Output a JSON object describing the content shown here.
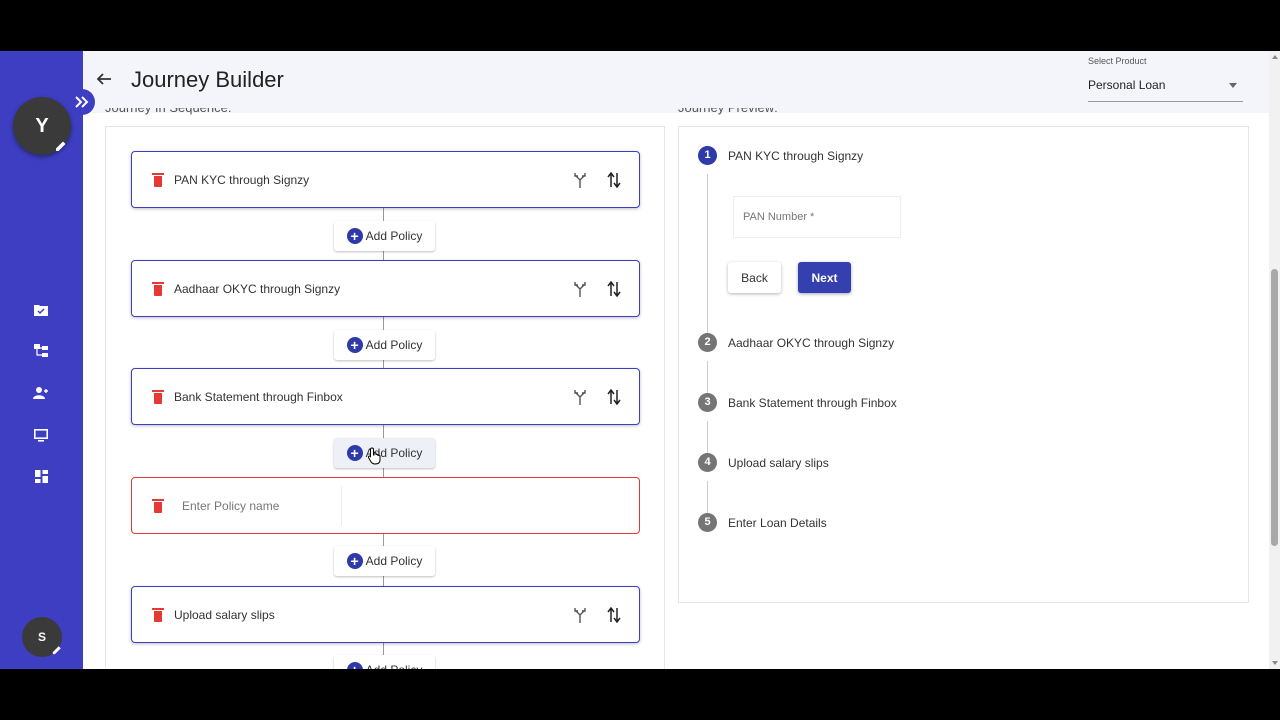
{
  "sidebar": {
    "avatar_initial": "Y",
    "user_initial": "S",
    "nav_items": [
      "folder-check-icon",
      "tree-structure-icon",
      "users-icon",
      "monitor-icon",
      "dashboard-icon"
    ]
  },
  "header": {
    "title": "Journey Builder",
    "product_select": {
      "label": "Select Product",
      "value": "Personal Loan"
    }
  },
  "left_panel": {
    "heading": "Journey In Sequence:",
    "policies": [
      {
        "name": "PAN KYC through Signzy"
      },
      {
        "name": "Aadhaar OKYC through Signzy"
      },
      {
        "name": "Bank Statement through Finbox"
      },
      {
        "name": "",
        "placeholder": "Enter Policy name",
        "editing": true
      },
      {
        "name": "Upload salary slips"
      }
    ],
    "add_policy_label": "Add Policy"
  },
  "right_panel": {
    "heading": "Journey Preview:",
    "steps": [
      {
        "num": "1",
        "label": "PAN KYC through Signzy",
        "active": true
      },
      {
        "num": "2",
        "label": "Aadhaar OKYC through Signzy"
      },
      {
        "num": "3",
        "label": "Bank Statement through Finbox"
      },
      {
        "num": "4",
        "label": "Upload salary slips"
      },
      {
        "num": "5",
        "label": "Enter Loan Details"
      }
    ],
    "pan_field_placeholder": "PAN Number *",
    "back_label": "Back",
    "next_label": "Next"
  },
  "colors": {
    "sidebar": "#3d3ec2",
    "primary": "#2e3aa8",
    "danger": "#e53935"
  }
}
